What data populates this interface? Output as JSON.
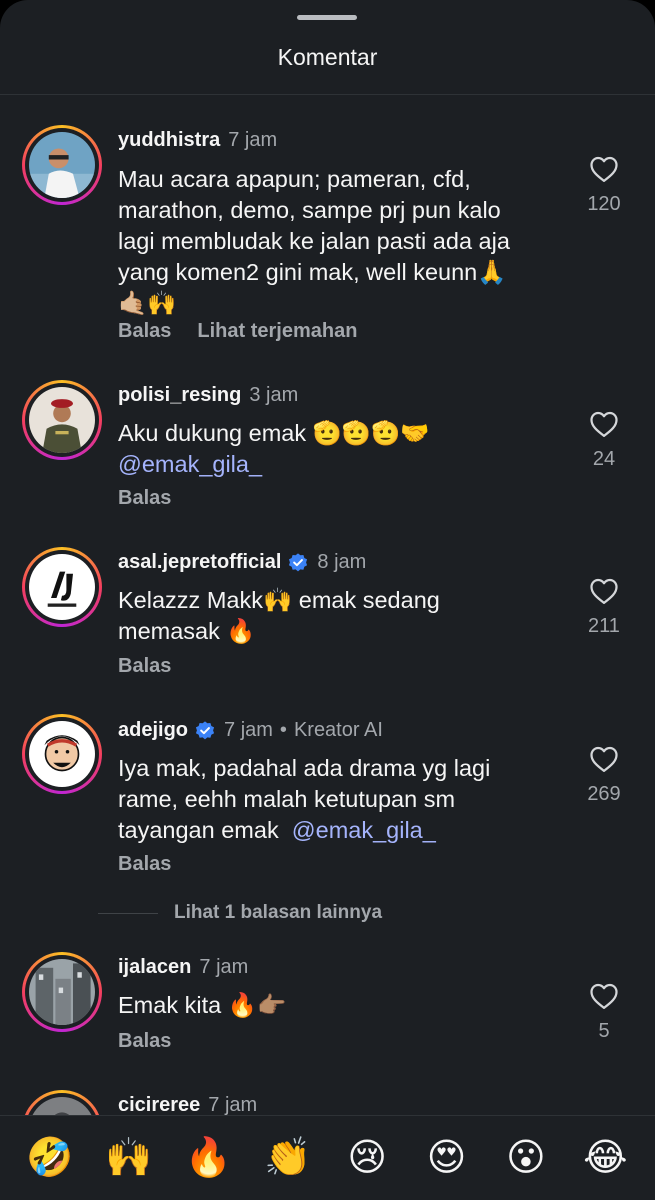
{
  "header": {
    "title": "Komentar"
  },
  "comments": [
    {
      "username": "yuddhistra",
      "time": "7 jam",
      "lines": [
        "Mau acara apapun; pameran, cfd,",
        "marathon, demo, sampe prj pun kalo",
        "lagi membludak ke jalan pasti ada aja",
        "yang komen2 gini mak, well keunn🙏",
        "🤙🏼🙌"
      ],
      "reply_label": "Balas",
      "translate_label": "Lihat terjemahan",
      "likes": "120"
    },
    {
      "username": "polisi_resing",
      "time": "3 jam",
      "line1": "Aku dukung emak 🫡🫡🫡🤝",
      "mention": "@emak_gila_",
      "reply_label": "Balas",
      "likes": "24"
    },
    {
      "username": "asal.jepretofficial",
      "time": "8 jam",
      "lines": [
        "Kelazzz Makk🙌 emak sedang",
        "memasak 🔥"
      ],
      "reply_label": "Balas",
      "likes": "211"
    },
    {
      "username": "adejigo",
      "time": "7 jam",
      "role": "Kreator AI",
      "lines": [
        "Iya mak, padahal ada drama yg lagi",
        "rame, eehh malah ketutupan sm"
      ],
      "line3_prefix": "tayangan emak",
      "mention": "@emak_gila_",
      "reply_label": "Balas",
      "likes": "269"
    },
    {
      "username": "ijalacen",
      "time": "7 jam",
      "text": "Emak kita 🔥👉🏽",
      "reply_label": "Balas",
      "likes": "5"
    },
    {
      "username": "cicireree",
      "time": "7 jam"
    }
  ],
  "more_replies": "Lihat 1 balasan lainnya",
  "emoji_bar": [
    "🤣",
    "🙌",
    "🔥",
    "👏",
    "😢",
    "😍",
    "😮",
    "😂"
  ],
  "colors": {
    "background": "#1c1f23",
    "secondary_text": "#a3a7ac",
    "mention": "#a5b4fc",
    "verified": "#3b82f6"
  }
}
